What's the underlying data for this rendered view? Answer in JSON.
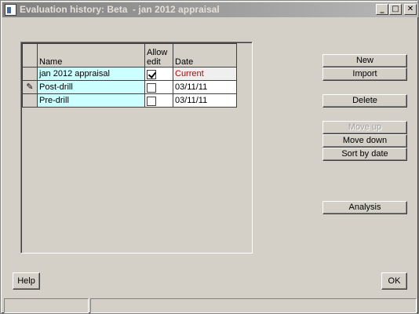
{
  "window": {
    "title": "Evaluation history: Beta  - jan 2012 appraisal",
    "minimize_glyph": "_",
    "maximize_glyph": "□",
    "close_glyph": "✕"
  },
  "grid": {
    "columns": {
      "name": "Name",
      "allow_edit": "Allow\nedit",
      "date": "Date"
    },
    "rows": [
      {
        "name": "jan 2012 appraisal",
        "allow_edit": true,
        "date": "Current",
        "marker": ""
      },
      {
        "name": "Post-drill",
        "allow_edit": false,
        "date": "03/11/11",
        "marker": "pencil-icon"
      },
      {
        "name": "Pre-drill",
        "allow_edit": false,
        "date": "03/11/11",
        "marker": ""
      }
    ]
  },
  "buttons": {
    "new": "New",
    "import": "Import",
    "delete": "Delete",
    "move_up": "Move up",
    "move_down": "Move down",
    "sort_by_date": "Sort by date",
    "analysis": "Analysis",
    "help": "Help",
    "ok": "OK"
  },
  "colors": {
    "name_cell_bg": "#ccffff",
    "current_text": "#c00000",
    "dialog_bg": "#d4d0c8"
  }
}
